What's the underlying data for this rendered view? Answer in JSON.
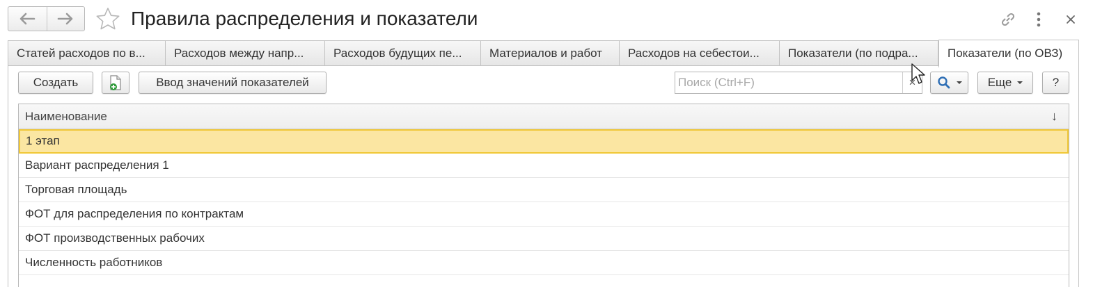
{
  "window": {
    "title": "Правила распределения и показатели",
    "icons": [
      "back-arrow-icon",
      "forward-arrow-icon",
      "star-icon",
      "link-icon",
      "more-vertical-icon",
      "close-icon"
    ]
  },
  "tabs": [
    {
      "label": "Статей расходов по в...",
      "active": false
    },
    {
      "label": "Расходов между напр...",
      "active": false
    },
    {
      "label": "Расходов будущих пе...",
      "active": false
    },
    {
      "label": "Материалов и работ",
      "active": false
    },
    {
      "label": "Расходов на себестои...",
      "active": false
    },
    {
      "label": "Показатели (по подра...",
      "active": false
    },
    {
      "label": "Показатели (по ОВЗ)",
      "active": true
    }
  ],
  "toolbar": {
    "create_label": "Создать",
    "enter_values_label": "Ввод значений показателей",
    "search_placeholder": "Поиск (Ctrl+F)",
    "search_clear": "×",
    "more_label": "Еще",
    "help_label": "?"
  },
  "grid": {
    "column_header": "Наименование",
    "sort_indicator": "↓",
    "rows": [
      "1 этап",
      "Вариант распределения 1",
      "Торговая площадь",
      "ФОТ для распределения по контрактам",
      "ФОТ производственных рабочих",
      "Численность работников"
    ],
    "selected_row": 0
  },
  "colors": {
    "selection_fill": "#fbe6a2",
    "selection_border": "#f0c736",
    "accent_blue": "#2f6fb5"
  }
}
